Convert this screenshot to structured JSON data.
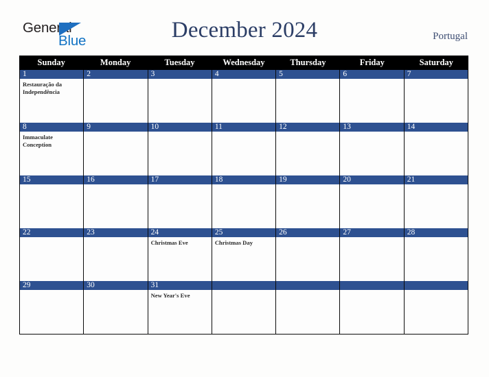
{
  "brand": {
    "name_part1": "General",
    "name_part2": "Blue",
    "triangle_icon": "triangle-icon",
    "colors": {
      "general_text": "#231f20",
      "blue_text": "#1273c4",
      "triangle": "#1e6fc0"
    }
  },
  "header": {
    "title": "December 2024",
    "country": "Portugal",
    "title_color": "#2c3e66"
  },
  "calendar": {
    "weekdays": [
      "Sunday",
      "Monday",
      "Tuesday",
      "Wednesday",
      "Thursday",
      "Friday",
      "Saturday"
    ],
    "header_background": "#000000",
    "day_bar_color": "#2e5191",
    "weeks": [
      [
        {
          "day": "1",
          "events": [
            "Restauração da Independência"
          ]
        },
        {
          "day": "2",
          "events": []
        },
        {
          "day": "3",
          "events": []
        },
        {
          "day": "4",
          "events": []
        },
        {
          "day": "5",
          "events": []
        },
        {
          "day": "6",
          "events": []
        },
        {
          "day": "7",
          "events": []
        }
      ],
      [
        {
          "day": "8",
          "events": [
            "Immaculate Conception"
          ]
        },
        {
          "day": "9",
          "events": []
        },
        {
          "day": "10",
          "events": []
        },
        {
          "day": "11",
          "events": []
        },
        {
          "day": "12",
          "events": []
        },
        {
          "day": "13",
          "events": []
        },
        {
          "day": "14",
          "events": []
        }
      ],
      [
        {
          "day": "15",
          "events": []
        },
        {
          "day": "16",
          "events": []
        },
        {
          "day": "17",
          "events": []
        },
        {
          "day": "18",
          "events": []
        },
        {
          "day": "19",
          "events": []
        },
        {
          "day": "20",
          "events": []
        },
        {
          "day": "21",
          "events": []
        }
      ],
      [
        {
          "day": "22",
          "events": []
        },
        {
          "day": "23",
          "events": []
        },
        {
          "day": "24",
          "events": [
            "Christmas Eve"
          ]
        },
        {
          "day": "25",
          "events": [
            "Christmas Day"
          ]
        },
        {
          "day": "26",
          "events": []
        },
        {
          "day": "27",
          "events": []
        },
        {
          "day": "28",
          "events": []
        }
      ],
      [
        {
          "day": "29",
          "events": []
        },
        {
          "day": "30",
          "events": []
        },
        {
          "day": "31",
          "events": [
            "New Year's Eve"
          ]
        },
        {
          "day": "",
          "events": []
        },
        {
          "day": "",
          "events": []
        },
        {
          "day": "",
          "events": []
        },
        {
          "day": "",
          "events": []
        }
      ]
    ]
  }
}
